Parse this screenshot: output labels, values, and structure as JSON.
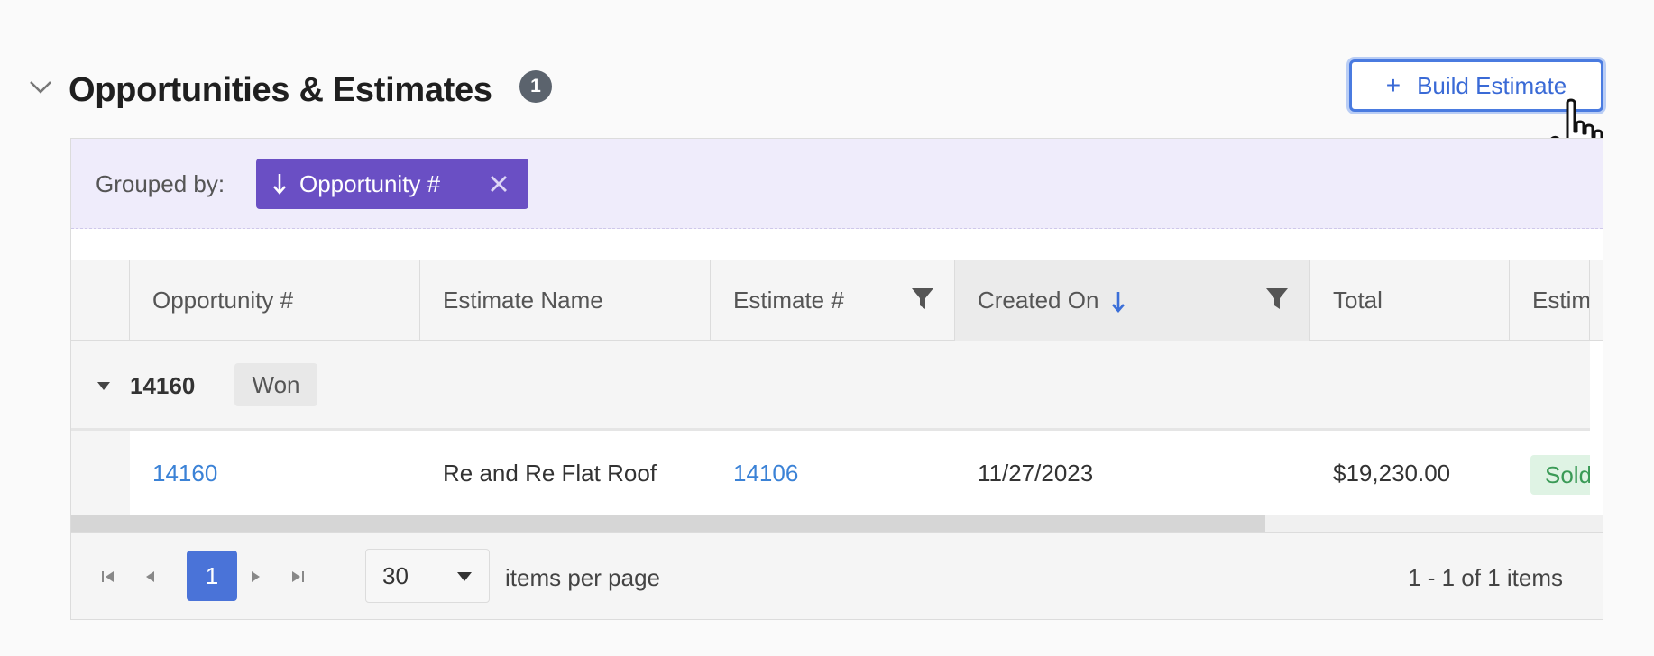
{
  "section": {
    "title": "Opportunities & Estimates",
    "count": "1",
    "build_button": {
      "icon": "plus-icon",
      "label": "Build Estimate"
    }
  },
  "grouping": {
    "label": "Grouped by:",
    "chip_label": "Opportunity #",
    "chip_icon": "arrow-down-icon"
  },
  "columns": [
    {
      "label": "Opportunity #"
    },
    {
      "label": "Estimate Name"
    },
    {
      "label": "Estimate #",
      "filter": true
    },
    {
      "label": "Created On",
      "sorted": "desc",
      "filter": true
    },
    {
      "label": "Total"
    },
    {
      "label": "Estim"
    }
  ],
  "group": {
    "value": "14160",
    "status": "Won"
  },
  "rows": [
    {
      "opportunity": "14160",
      "estimate_name": "Re and Re Flat Roof",
      "estimate_number": "14106",
      "created_on": "11/27/2023",
      "total": "$19,230.00",
      "status": "Sold"
    }
  ],
  "pager": {
    "current_page": "1",
    "page_size": "30",
    "items_per_page_label": "items per page",
    "info": "1 - 1 of 1 items"
  },
  "colors": {
    "accent": "#4a73d8",
    "group_chip": "#6a4fc4",
    "link": "#3b82d6",
    "sold_bg": "#dff3e4",
    "sold_text": "#3a9a56"
  }
}
